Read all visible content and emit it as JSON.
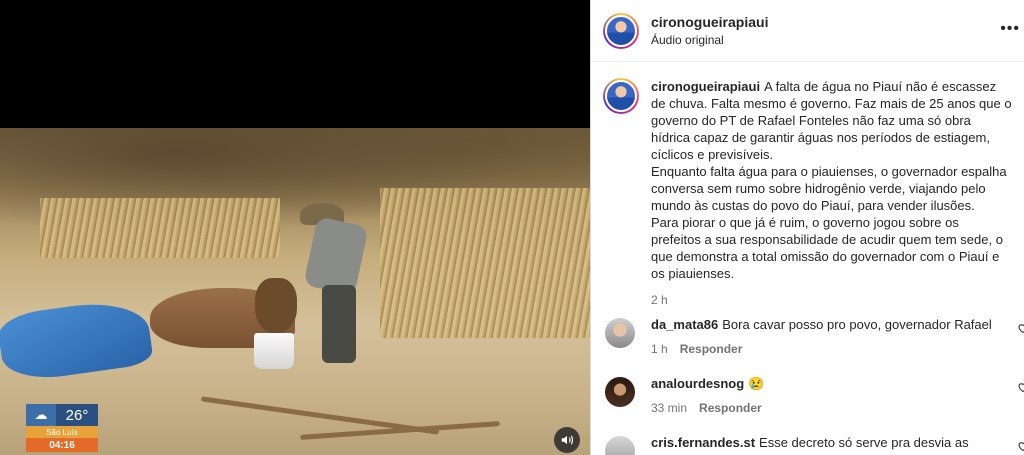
{
  "video": {
    "weather": {
      "icon": "cloud-sun-icon",
      "temperature": "26°",
      "city": "São Luís",
      "time": "04:16"
    },
    "audio_icon": "speaker-icon"
  },
  "post": {
    "username": "cironogueirapiaui",
    "audio": "Áudio original",
    "more_icon": "more-options-icon",
    "caption": {
      "username": "cironogueirapiaui",
      "paragraphs": [
        "A falta de água no Piauí não é escassez de chuva. Falta mesmo é governo. Faz mais de 25 anos que o governo do PT de Rafael Fonteles não faz uma só obra hídrica capaz de garantir águas nos períodos de estiagem, cíclicos e previsíveis.",
        "Enquanto falta água para o piauienses, o governador espalha conversa sem rumo sobre hidrogênio verde, viajando pelo mundo às custas do povo do Piauí, para vender ilusões.",
        "Para piorar o que já é ruim, o governo jogou sobre os prefeitos a sua responsabilidade de acudir quem tem sede, o que demonstra a total omissão do governador com o Piauí e os piauienses."
      ],
      "time": "2 h"
    }
  },
  "comments": [
    {
      "username": "da_mata86",
      "text": "Bora cavar posso pro povo, governador Rafael",
      "time": "1 h",
      "reply": "Responder"
    },
    {
      "username": "analourdesnog",
      "text": "😢",
      "time": "33 min",
      "reply": "Responder"
    },
    {
      "username": "cris.fernandes.st",
      "text": "Esse decreto só serve pra desvia as",
      "time": "",
      "reply": ""
    }
  ]
}
